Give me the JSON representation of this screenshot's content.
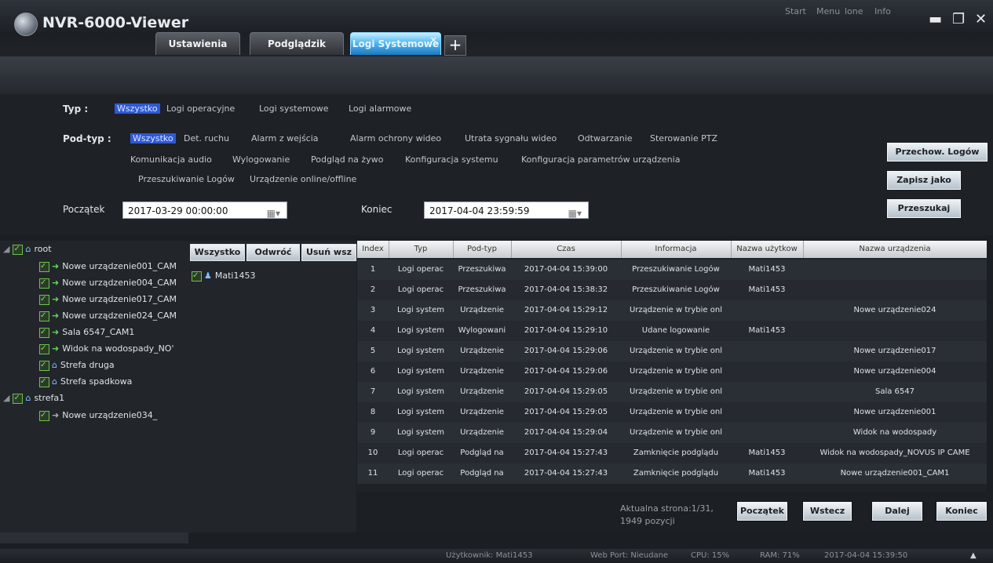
{
  "app": {
    "title": "NVR-6000-Viewer",
    "icon": "camera-app-icon"
  },
  "window": {
    "top_links": [
      "Start",
      "Menu",
      "lone",
      "Info"
    ],
    "minimize": "▬",
    "maximize": "❐",
    "close": "✕"
  },
  "tabs": [
    {
      "label": "Ustawienia",
      "active": false
    },
    {
      "label": "Podglądzik",
      "active": false
    },
    {
      "label": "Logi Systemowe",
      "active": true,
      "close": "✕"
    }
  ],
  "add_tab": "+",
  "filters": {
    "typ_label": "Typ :",
    "typ_items": [
      "Wszystko",
      "Logi operacyjne",
      "Logi systemowe",
      "Logi alarmowe"
    ],
    "podtyp_label": "Pod-typ :",
    "podtyp_row1": [
      "Wszystko",
      "Det. ruchu",
      "Alarm z wejścia",
      "Alarm ochrony wideo",
      "Utrata sygnału wideo",
      "Odtwarzanie",
      "Sterowanie PTZ"
    ],
    "podtyp_row2": [
      "Komunikacja audio",
      "Wylogowanie",
      "Podgląd na żywo",
      "Konfiguracja systemu",
      "Konfiguracja parametrów urządzenia"
    ],
    "podtyp_row3": [
      "Przeszukiwanie Logów",
      "Urządzenie online/offline"
    ],
    "start_label": "Początek",
    "start_value": "2017-03-29 00:00:00",
    "end_label": "Koniec",
    "end_value": "2017-04-04 23:59:59",
    "calendar_icon": "▦▾"
  },
  "actions": {
    "store": "Przechow. Logów",
    "save_as": "Zapisz jako",
    "search": "Przeszukaj"
  },
  "tree": {
    "root": "root",
    "items": [
      "Nowe urządzenie001_CAM",
      "Nowe urządzenie004_CAM",
      "Nowe urządzenie017_CAM",
      "Nowe urządzenie024_CAM",
      "Sala 6547_CAM1",
      "Widok na wodospady_NO'",
      "Strefa druga",
      "Strefa spadkowa"
    ],
    "zone": "strefa1",
    "zone_items": [
      "Nowe urządzenie034_"
    ]
  },
  "users": {
    "buttons": [
      "Wszystko",
      "Odwróć",
      "Usuń wsz"
    ],
    "list": [
      "Mati1453"
    ]
  },
  "table": {
    "columns": [
      "Index",
      "Typ",
      "Pod-typ",
      "Czas",
      "Informacja",
      "Nazwa użytkow",
      "Nazwa urządzenia"
    ],
    "rows": [
      [
        "1",
        "Logi operac",
        "Przeszukiwa",
        "2017-04-04 15:39:00",
        "Przeszukiwanie Logów",
        "Mati1453",
        ""
      ],
      [
        "2",
        "Logi operac",
        "Przeszukiwa",
        "2017-04-04 15:38:32",
        "Przeszukiwanie Logów",
        "Mati1453",
        ""
      ],
      [
        "3",
        "Logi system",
        "Urządzenie",
        "2017-04-04 15:29:12",
        "Urządzenie w trybie onl",
        "",
        "Nowe urządzenie024"
      ],
      [
        "4",
        "Logi system",
        "Wylogowani",
        "2017-04-04 15:29:10",
        "Udane logowanie",
        "Mati1453",
        ""
      ],
      [
        "5",
        "Logi system",
        "Urządzenie",
        "2017-04-04 15:29:06",
        "Urządzenie w trybie onl",
        "",
        "Nowe urządzenie017"
      ],
      [
        "6",
        "Logi system",
        "Urządzenie",
        "2017-04-04 15:29:06",
        "Urządzenie w trybie onl",
        "",
        "Nowe urządzenie004"
      ],
      [
        "7",
        "Logi system",
        "Urządzenie",
        "2017-04-04 15:29:05",
        "Urządzenie w trybie onl",
        "",
        "Sala 6547"
      ],
      [
        "8",
        "Logi system",
        "Urządzenie",
        "2017-04-04 15:29:05",
        "Urządzenie w trybie onl",
        "",
        "Nowe urządzenie001"
      ],
      [
        "9",
        "Logi system",
        "Urządzenie",
        "2017-04-04 15:29:04",
        "Urządzenie w trybie onl",
        "",
        "Widok na wodospady"
      ],
      [
        "10",
        "Logi operac",
        "Podgląd na",
        "2017-04-04 15:27:43",
        "Zamknięcie podglądu",
        "Mati1453",
        "Widok na wodospady_NOVUS IP CAME"
      ],
      [
        "11",
        "Logi operac",
        "Podgląd na",
        "2017-04-04 15:27:43",
        "Zamknięcie podglądu",
        "Mati1453",
        "Nowe urządzenie001_CAM1"
      ]
    ]
  },
  "pager": {
    "info_line1": "Aktualna strona:1/31,",
    "info_line2": "1949 pozycji",
    "buttons": [
      "Początek",
      "Wstecz",
      "Dalej",
      "Koniec"
    ]
  },
  "status": {
    "user": "Użytkownik: Mati1453",
    "web": "Web Port: Nieudane",
    "cpu": "CPU: 15%",
    "ram": "RAM: 71%",
    "time": "2017-04-04 15:39:50",
    "expand_icon": "▲"
  }
}
